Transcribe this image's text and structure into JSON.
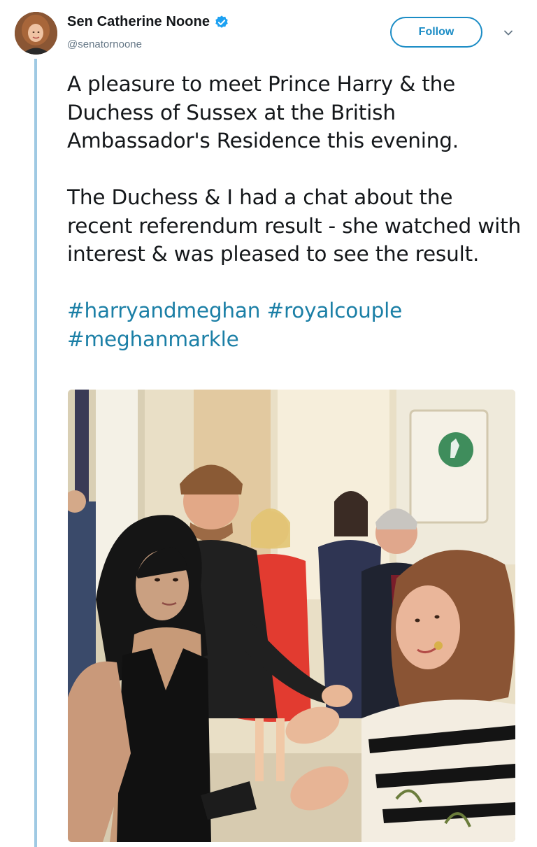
{
  "tweet": {
    "author": {
      "display_name": "Sen Catherine Noone",
      "handle": "@senatornoone",
      "verified": true
    },
    "follow_label": "Follow",
    "text_paragraph_1": "A pleasure to meet Prince Harry & the Duchess of Sussex at the British Ambassador's Residence this evening.",
    "text_paragraph_2": "The Duchess & I had a chat about the recent referendum result - she watched with interest & was pleased to see the result.",
    "hashtags": [
      "#harryandmeghan",
      "#royalcouple",
      "#meghanmarkle"
    ],
    "media": {
      "type": "photo"
    }
  },
  "colors": {
    "link": "#1b7fa6",
    "follow_blue": "#1b8cc5",
    "thread_line": "#9fc9e3",
    "secondary_text": "#657786",
    "verified_blue": "#1da1f2"
  },
  "icons": {
    "verified": "verified-badge-icon",
    "caret": "chevron-down-icon"
  }
}
